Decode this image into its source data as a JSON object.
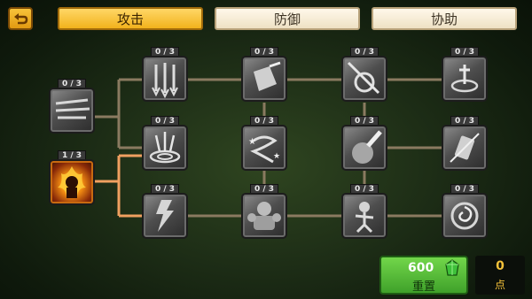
{
  "tabs": [
    {
      "label": "攻击",
      "active": true
    },
    {
      "label": "防御",
      "active": false
    },
    {
      "label": "协助",
      "active": false
    }
  ],
  "back_button": {
    "icon": "return-arrow-icon"
  },
  "skills": [
    {
      "id": "root-wind-slash",
      "count": "0 / 3",
      "icon": "wind-slash-icon"
    },
    {
      "id": "root-flame-warrior",
      "count": "1 / 3",
      "icon": "flame-warrior-icon",
      "unlocked": true
    },
    {
      "id": "r1-triple-arrow",
      "count": "0 / 3",
      "icon": "triple-arrow-icon"
    },
    {
      "id": "r1-shield-crash",
      "count": "0 / 3",
      "icon": "shield-crash-icon"
    },
    {
      "id": "r1-burst-ring",
      "count": "0 / 3",
      "icon": "burst-ring-icon"
    },
    {
      "id": "r1-swirl-figure",
      "count": "0 / 3",
      "icon": "swirl-figure-icon"
    },
    {
      "id": "r2-ground-vortex",
      "count": "0 / 3",
      "icon": "ground-vortex-icon"
    },
    {
      "id": "r2-star-tornado",
      "count": "0 / 3",
      "icon": "star-tornado-icon"
    },
    {
      "id": "r2-hammer-strike",
      "count": "0 / 3",
      "icon": "hammer-strike-icon"
    },
    {
      "id": "r2-card-slash",
      "count": "0 / 3",
      "icon": "card-slash-icon"
    },
    {
      "id": "r3-lightning-beast",
      "count": "0 / 3",
      "icon": "lightning-beast-icon"
    },
    {
      "id": "r3-stone-golem",
      "count": "0 / 3",
      "icon": "stone-golem-icon"
    },
    {
      "id": "r3-dancing-spirit",
      "count": "0 / 3",
      "icon": "dancing-spirit-icon"
    },
    {
      "id": "r3-spiral-orb",
      "count": "0 / 3",
      "icon": "spiral-orb-icon"
    }
  ],
  "reset": {
    "cost": "600",
    "label": "重置",
    "currency_icon": "green-gem-icon"
  },
  "points": {
    "value": "0",
    "unit": "点"
  },
  "colors": {
    "active_link": "#f0a060",
    "inactive_link": "#8a7a60",
    "tab_active": "#f7c533",
    "reset_green": "#5cc23a",
    "points_gold": "#f4c23a"
  }
}
